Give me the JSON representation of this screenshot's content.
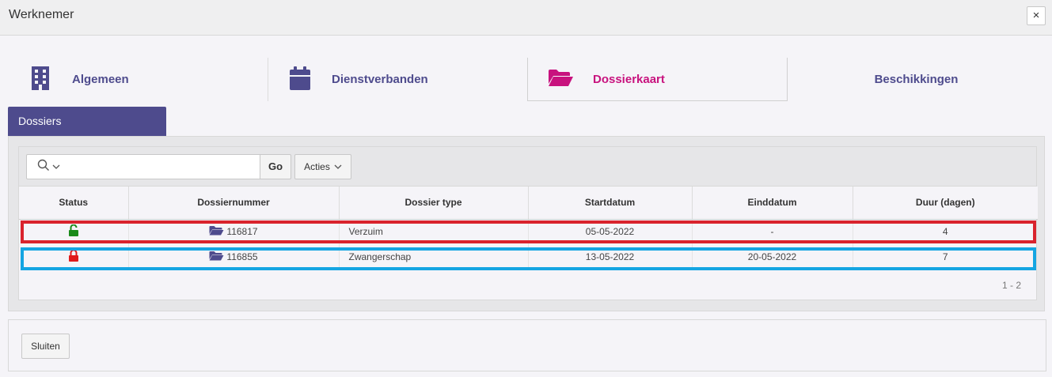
{
  "window": {
    "title": "Werknemer",
    "close_label": "×"
  },
  "tabs": [
    {
      "label": "Algemeen",
      "icon": "building-icon",
      "active": false
    },
    {
      "label": "Dienstverbanden",
      "icon": "calendar-icon",
      "active": false
    },
    {
      "label": "Dossierkaart",
      "icon": "folder-open-icon",
      "active": true
    },
    {
      "label": "Beschikkingen",
      "icon": "",
      "active": false
    }
  ],
  "region": {
    "title": "Dossiers"
  },
  "toolbar": {
    "search_value": "",
    "go_label": "Go",
    "actions_label": "Acties"
  },
  "table": {
    "columns": [
      "Status",
      "Dossiernummer",
      "Dossier type",
      "Startdatum",
      "Einddatum",
      "Duur (dagen)"
    ],
    "rows": [
      {
        "status": "unlocked",
        "status_color": "#1a8a1a",
        "number": "116817",
        "type": "Verzuim",
        "start": "05-05-2022",
        "end": "-",
        "duration": "4"
      },
      {
        "status": "locked",
        "status_color": "#e01b1b",
        "number": "116855",
        "type": "Zwangerschap",
        "start": "13-05-2022",
        "end": "20-05-2022",
        "duration": "7"
      }
    ],
    "pagination": "1 - 2"
  },
  "footer": {
    "close_label": "Sluiten"
  },
  "colors": {
    "brand": "#4e4b8d",
    "active_tab": "#c8127e",
    "highlight_red": "#d9232d",
    "highlight_blue": "#14a5e2"
  }
}
